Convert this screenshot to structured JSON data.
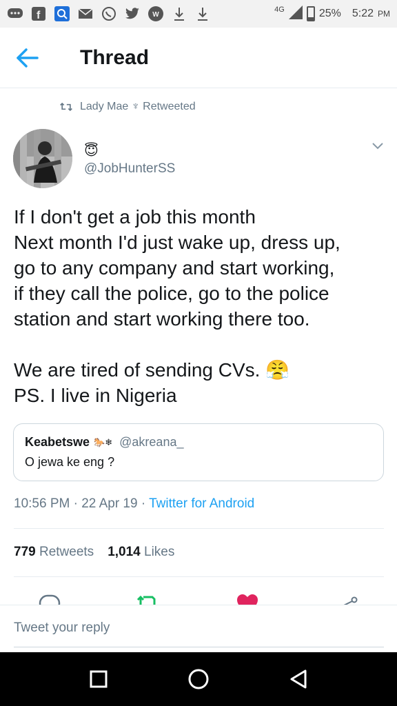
{
  "status_bar": {
    "network": "4G",
    "battery": "25%",
    "time": "5:22",
    "time_suffix": "PM"
  },
  "header": {
    "title": "Thread"
  },
  "retweet_context": {
    "text": "Lady Mae ♆ Retweeted"
  },
  "tweet": {
    "emoji": "😇",
    "handle": "@JobHunterSS",
    "lines": [
      "If I don't get a job this month",
      "Next month I'd just wake up, dress up,",
      "go to any company and start working,",
      "if they call the police, go to the police",
      "station and start working there too."
    ],
    "line2": "We are tired of sending CVs. 😤",
    "line3": "PS. I live in Nigeria",
    "timestamp": "10:56 PM · 22 Apr 19 · ",
    "source": "Twitter for Android"
  },
  "quote": {
    "name": "Keabetswe",
    "name_emoji": "🐎❄",
    "handle": "@akreana_",
    "text": "O jewa ke eng ?"
  },
  "counts": {
    "retweets_value": "779",
    "retweets_label": "Retweets",
    "likes_value": "1,014",
    "likes_label": "Likes"
  },
  "reply": {
    "placeholder": "Tweet your reply"
  },
  "colors": {
    "accent": "#1da1f2",
    "retweet_green": "#17bf63",
    "like_red": "#e0245e",
    "secondary_text": "#657786"
  }
}
